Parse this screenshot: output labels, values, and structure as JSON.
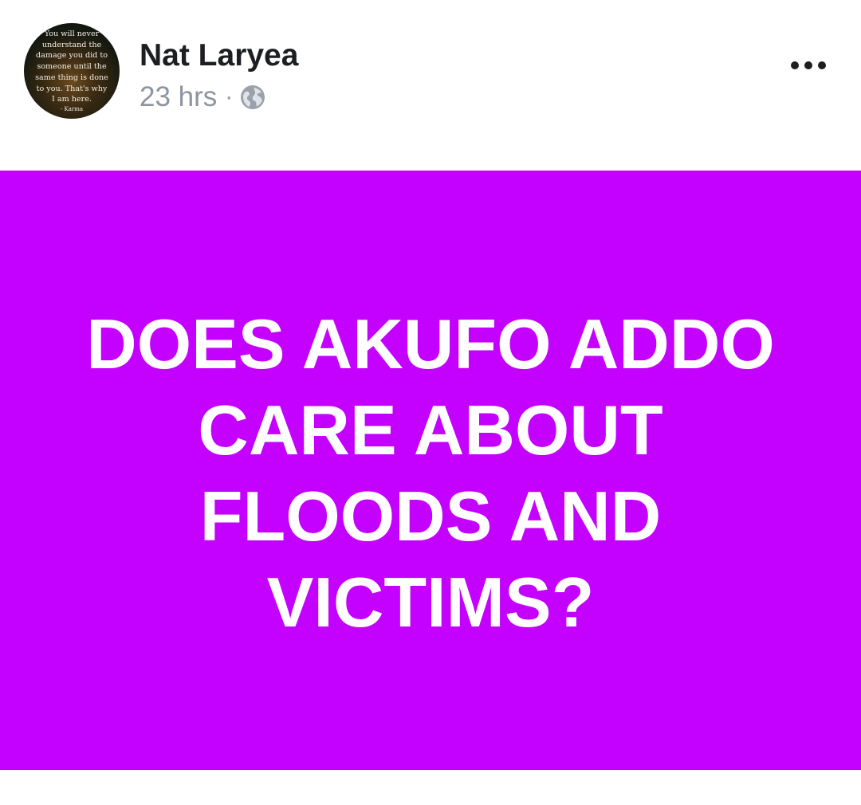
{
  "post": {
    "author": {
      "name": "Nat Laryea",
      "avatar_text_lines": [
        "You will never",
        "understand the",
        "damage you did to",
        "someone until the",
        "same thing is done",
        "to you. That's why",
        "I am here."
      ],
      "avatar_signature": "- Karma"
    },
    "timestamp": "23 hrs",
    "separator": "·",
    "privacy_icon": "globe-icon",
    "more_icon": "more-options-icon",
    "image": {
      "background_color": "#c400ff",
      "text_color": "#ffffff",
      "text_lines": [
        "DOES AKUFO ADDO",
        "CARE ABOUT",
        "FLOODS AND",
        "VICTIMS?"
      ]
    }
  }
}
